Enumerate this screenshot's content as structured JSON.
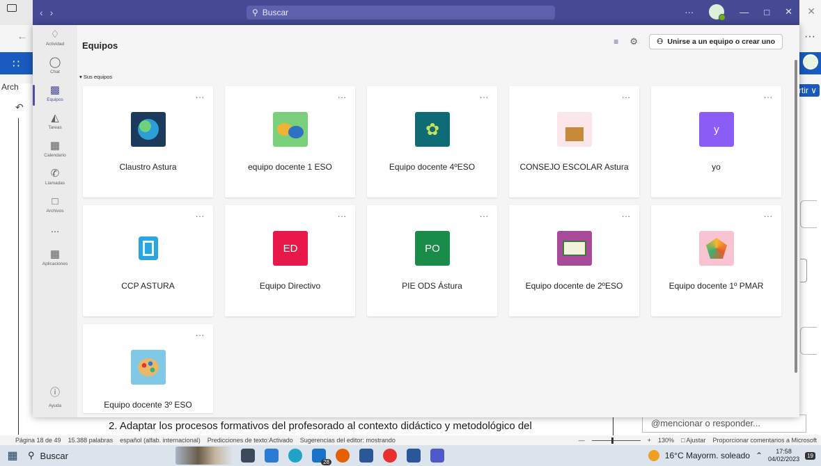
{
  "background_word": {
    "ribbon_fragment": "Arch",
    "share_fragment": "rtir",
    "document_line": "2. Adaptar los procesos formativos del profesorado al contexto didáctico y metodológico del",
    "mention_placeholder": "@mencionar o responder...",
    "status": {
      "page": "Página 18 de 49",
      "words": "15.388 palabras",
      "language": "español (alfab. internacional)",
      "predictions": "Predicciones de texto:Activado",
      "editor": "Sugerencias del editor: mostrando",
      "zoom": "130%",
      "fit": "Ajustar",
      "feedback": "Proporcionar comentarios a Microsoft"
    }
  },
  "taskbar": {
    "search": "Buscar",
    "badge": "28",
    "weather": "16°C  Mayorm. soleado",
    "time": "17:58",
    "date": "04/02/2023",
    "notif": "19"
  },
  "teams": {
    "search_placeholder": "Buscar",
    "rail": [
      {
        "label": "Actividad",
        "icon": "bell-icon"
      },
      {
        "label": "Chat",
        "icon": "chat-icon"
      },
      {
        "label": "Equipos",
        "icon": "teams-icon"
      },
      {
        "label": "Tareas",
        "icon": "tasks-icon"
      },
      {
        "label": "Calendario",
        "icon": "calendar-icon"
      },
      {
        "label": "Llamadas",
        "icon": "phone-icon"
      },
      {
        "label": "Archivos",
        "icon": "file-icon"
      },
      {
        "label": "...",
        "icon": "more-icon"
      },
      {
        "label": "Aplicaciones",
        "icon": "apps-icon"
      }
    ],
    "help_label": "Ayuda",
    "page_title": "Equipos",
    "join_button": "Unirse a un equipo o crear uno",
    "section_label": "Sus equipos",
    "teams": [
      {
        "name": "Claustro Astura",
        "tile_text": "",
        "tile_icon": "globe-icon",
        "color": "#1b3a5c"
      },
      {
        "name": "equipo docente 1 ESO",
        "tile_text": "",
        "tile_icon": "speech-bubbles-icon",
        "color": "#7bd17b"
      },
      {
        "name": "Equipo docente 4ºESO",
        "tile_text": "",
        "tile_icon": "laurel-icon",
        "color": "#0f6b75"
      },
      {
        "name": "CONSEJO ESCOLAR Astura",
        "tile_text": "",
        "tile_icon": "podium-icon",
        "color": "#fbe6ea"
      },
      {
        "name": "yo",
        "tile_text": "y",
        "tile_icon": "",
        "color": "#8b5cf6"
      },
      {
        "name": "CCP ASTURA",
        "tile_text": "",
        "tile_icon": "scroll-icon",
        "color": "#ffffff"
      },
      {
        "name": "Equipo Directivo",
        "tile_text": "ED",
        "tile_icon": "",
        "color": "#e8184a"
      },
      {
        "name": "PIE ODS Ástura",
        "tile_text": "PO",
        "tile_icon": "",
        "color": "#1a8c4a"
      },
      {
        "name": "Equipo docente de 2ºESO",
        "tile_text": "",
        "tile_icon": "book-icon",
        "color": "#a84a9a"
      },
      {
        "name": "Equipo docente 1º PMAR",
        "tile_text": "",
        "tile_icon": "polyhedron-icon",
        "color": "#f9c4d2"
      },
      {
        "name": "Equipo docente 3º ESO",
        "tile_text": "",
        "tile_icon": "palette-icon",
        "color": "#7fc9e6"
      }
    ],
    "more_label": "..."
  }
}
